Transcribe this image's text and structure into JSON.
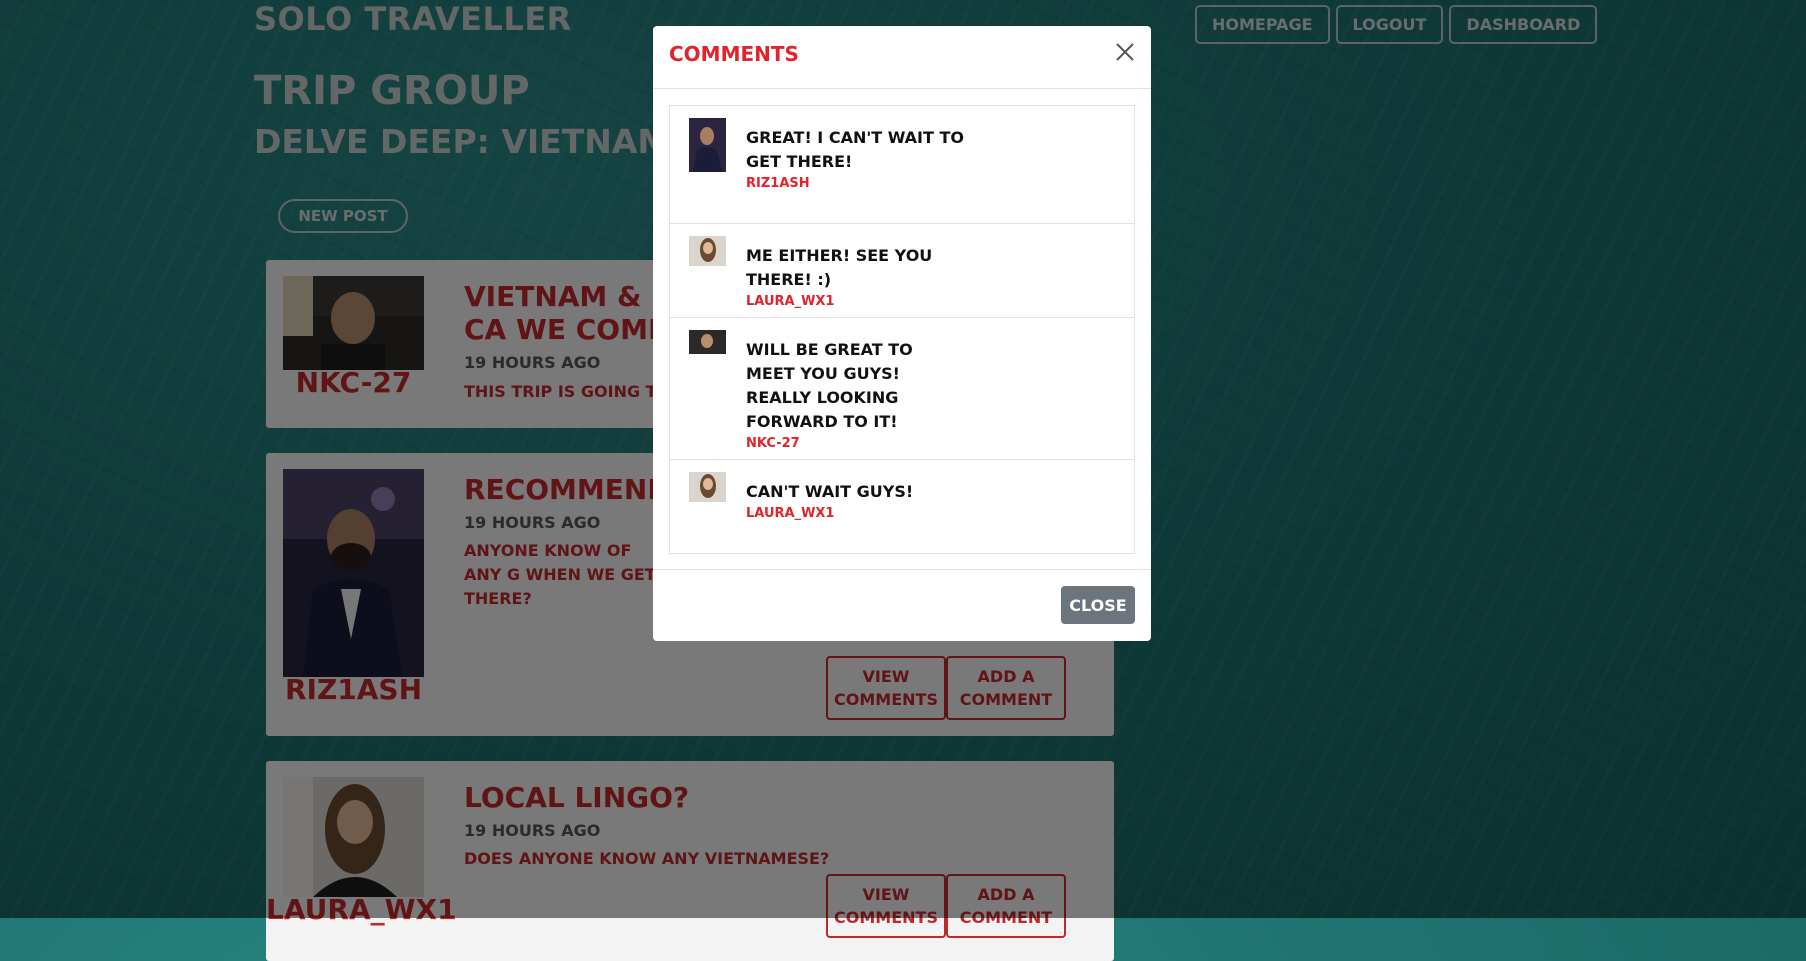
{
  "app": {
    "brand": "SOLO TRAVELLER"
  },
  "nav": {
    "homepage": "HOMEPAGE",
    "logout": "LOGOUT",
    "dashboard": "DASHBOARD"
  },
  "group": {
    "title": "TRIP GROUP",
    "trip_name": "DELVE DEEP: VIETNAM & CA"
  },
  "new_post_label": "NEW POST",
  "posts": [
    {
      "author": "NKC-27",
      "title": "VIETNAM & CA WE COME!",
      "time": "19 HOURS AGO",
      "body": "THIS TRIP IS GOING TO BE"
    },
    {
      "author": "RIZ1ASH",
      "title": "RECOMMENDA",
      "time": "19 HOURS AGO",
      "body": "ANYONE KNOW OF ANY G WHEN WE GET THERE?",
      "view_label": "VIEW COMMENTS",
      "add_label": "ADD A COMMENT"
    },
    {
      "author": "LAURA_WX1",
      "title": "LOCAL LINGO?",
      "time": "19 HOURS AGO",
      "body": "DOES ANYONE KNOW ANY VIETNAMESE?",
      "view_label": "VIEW COMMENTS",
      "add_label": "ADD A COMMENT"
    }
  ],
  "modal": {
    "title": "COMMENTS",
    "close_label": "CLOSE",
    "comments": [
      {
        "text": "GREAT! I CAN'T WAIT TO GET THERE!",
        "user": "RIZ1ASH"
      },
      {
        "text": "ME EITHER! SEE YOU THERE! :)",
        "user": "LAURA_WX1"
      },
      {
        "text": "WILL BE GREAT TO MEET YOU GUYS! REALLY LOOKING FORWARD TO IT!",
        "user": "NKC-27"
      },
      {
        "text": "CAN'T WAIT GUYS!",
        "user": "LAURA_WX1"
      }
    ]
  },
  "colors": {
    "accent": "#c0282a",
    "modal_accent": "#e0242a",
    "close_button": "#6c757d"
  }
}
